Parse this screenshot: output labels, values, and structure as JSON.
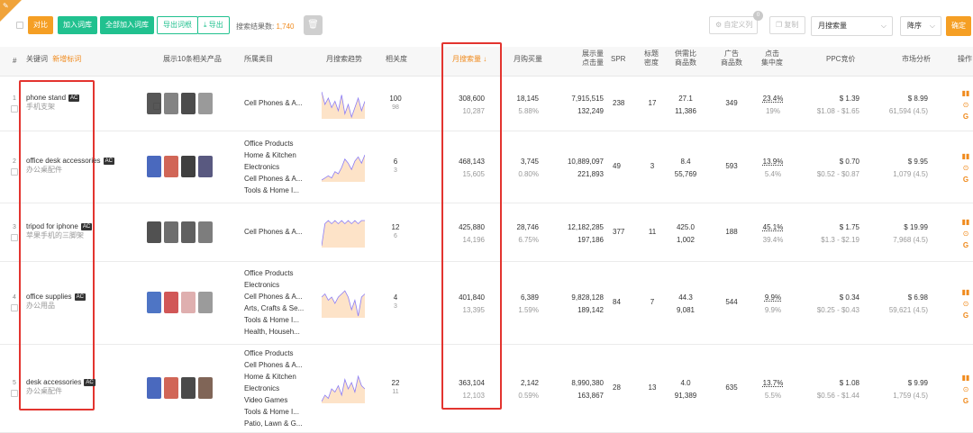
{
  "toolbar": {
    "compare_label": "对比",
    "add_lexicon_label": "加入词库",
    "add_all_lexicon_label": "全部加入词库",
    "export_root_label": "导出词根",
    "export_label": "导出",
    "search_count_label": "搜索结果数: ",
    "search_count_value": "1,740",
    "custom_columns_label": "自定义列",
    "custom_columns_badge": "0",
    "copy_label": "复制",
    "sort_field_value": "月搜索量",
    "sort_order_value": "降序",
    "confirm_label": "确定"
  },
  "header": {
    "index": "#",
    "keyword": "关键词",
    "keyword_sublabel": "新增标词",
    "show_products": "展示10条相关产品",
    "category": "所属类目",
    "trend": "月搜索趋势",
    "relevance": "相关度",
    "monthly_search": "月搜索量 ↓",
    "monthly_purchase": "月购买量",
    "impressions_clicks_1": "展示量",
    "impressions_clicks_2": "点击量",
    "spr": "SPR",
    "title_density_1": "标题",
    "title_density_2": "密度",
    "supply_demand_1": "供需比",
    "supply_demand_2": "商品数",
    "ad_products_1": "广告",
    "ad_products_2": "商品数",
    "click_concentration_1": "点击",
    "click_concentration_2": "集中度",
    "ppc": "PPC竞价",
    "market": "市场分析",
    "ops": "操作"
  },
  "rows": [
    {
      "index": "1",
      "keyword": "phone stand",
      "ac": "AC",
      "translation": "手机支架",
      "categories": [
        "Cell Phones & A..."
      ],
      "relevance": "100",
      "relevance_sub": "98",
      "monthly_search": "308,600",
      "monthly_search_sub": "10,287",
      "purchase": "18,145",
      "purchase_rate": "5.88%",
      "impressions": "7,915,515",
      "clicks": "132,249",
      "spr": "238",
      "title_density": "17",
      "supply_ratio": "27.1",
      "product_count": "11,386",
      "ad_products": "349",
      "click_conc": "23.4%",
      "click_conc_sub": "19%",
      "ppc": "$ 1.39",
      "ppc_range": "$1.08 - $1.65",
      "market_price": "$ 8.99",
      "market_sub": "61,594 (4.5)",
      "trend": [
        14,
        10,
        12,
        9,
        11,
        8,
        13,
        7,
        10,
        6,
        9,
        12,
        8,
        11
      ]
    },
    {
      "index": "2",
      "keyword": "office desk accessories",
      "ac": "AC",
      "translation": "办公桌配件",
      "categories": [
        "Office Products",
        "Home & Kitchen",
        "Electronics",
        "Cell Phones & A...",
        "Tools & Home I..."
      ],
      "relevance": "6",
      "relevance_sub": "3",
      "monthly_search": "468,143",
      "monthly_search_sub": "15,605",
      "purchase": "3,745",
      "purchase_rate": "0.80%",
      "impressions": "10,889,097",
      "clicks": "221,893",
      "spr": "49",
      "title_density": "3",
      "supply_ratio": "8.4",
      "product_count": "55,769",
      "ad_products": "593",
      "click_conc": "13.9%",
      "click_conc_sub": "5.4%",
      "ppc": "$ 0.70",
      "ppc_range": "$0.52 - $0.87",
      "market_price": "$ 9.95",
      "market_sub": "1,079 (4.5)",
      "trend": [
        4,
        5,
        6,
        5,
        8,
        7,
        10,
        14,
        12,
        9,
        13,
        15,
        12,
        16
      ]
    },
    {
      "index": "3",
      "keyword": "tripod for iphone",
      "ac": "AC",
      "translation": "苹果手机的三脚架",
      "categories": [
        "Cell Phones & A..."
      ],
      "relevance": "12",
      "relevance_sub": "6",
      "monthly_search": "425,880",
      "monthly_search_sub": "14,196",
      "purchase": "28,746",
      "purchase_rate": "6.75%",
      "impressions": "12,182,285",
      "clicks": "197,186",
      "spr": "377",
      "title_density": "11",
      "supply_ratio": "425.0",
      "product_count": "1,002",
      "ad_products": "188",
      "click_conc": "45.1%",
      "click_conc_sub": "39.4%",
      "ppc": "$ 1.75",
      "ppc_range": "$1.3 - $2.19",
      "market_price": "$ 19.99",
      "market_sub": "7,968 (4.5)",
      "trend": [
        6,
        13,
        14,
        13,
        14,
        13,
        14,
        13,
        14,
        13,
        14,
        13,
        14,
        14
      ]
    },
    {
      "index": "4",
      "keyword": "office supplies",
      "ac": "AC",
      "translation": "办公用品",
      "categories": [
        "Office Products",
        "Electronics",
        "Cell Phones & A...",
        "Arts, Crafts & Se...",
        "Tools & Home I...",
        "Health, Househ..."
      ],
      "relevance": "4",
      "relevance_sub": "3",
      "monthly_search": "401,840",
      "monthly_search_sub": "13,395",
      "purchase": "6,389",
      "purchase_rate": "1.59%",
      "impressions": "9,828,128",
      "clicks": "189,142",
      "spr": "84",
      "title_density": "7",
      "supply_ratio": "44.3",
      "product_count": "9,081",
      "ad_products": "544",
      "click_conc": "9.9%",
      "click_conc_sub": "9.9%",
      "ppc": "$ 0.34",
      "ppc_range": "$0.25 - $0.43",
      "market_price": "$ 6.98",
      "market_sub": "59,621 (4.5)",
      "trend": [
        12,
        13,
        11,
        12,
        10,
        12,
        13,
        14,
        12,
        8,
        11,
        6,
        12,
        13
      ]
    },
    {
      "index": "5",
      "keyword": "desk accessories",
      "ac": "AC",
      "translation": "办公桌配件",
      "categories": [
        "Office Products",
        "Cell Phones & A...",
        "Home & Kitchen",
        "Electronics",
        "Video Games",
        "Tools & Home I...",
        "Patio, Lawn & G..."
      ],
      "relevance": "22",
      "relevance_sub": "11",
      "monthly_search": "363,104",
      "monthly_search_sub": "12,103",
      "purchase": "2,142",
      "purchase_rate": "0.59%",
      "impressions": "8,990,380",
      "clicks": "163,867",
      "spr": "28",
      "title_density": "13",
      "supply_ratio": "4.0",
      "product_count": "91,389",
      "ad_products": "635",
      "click_conc": "13.7%",
      "click_conc_sub": "5.5%",
      "ppc": "$ 1.08",
      "ppc_range": "$0.56 - $1.44",
      "market_price": "$ 9.99",
      "market_sub": "1,759 (4.5)",
      "trend": [
        5,
        7,
        6,
        9,
        8,
        10,
        7,
        12,
        9,
        11,
        8,
        13,
        10,
        9
      ]
    }
  ],
  "colors": {
    "accent_orange": "#f59f24",
    "accent_green": "#21c18f",
    "highlight_red": "#e3342f",
    "spark_line": "#8b7cf6",
    "spark_fill": "#fde3c8"
  }
}
